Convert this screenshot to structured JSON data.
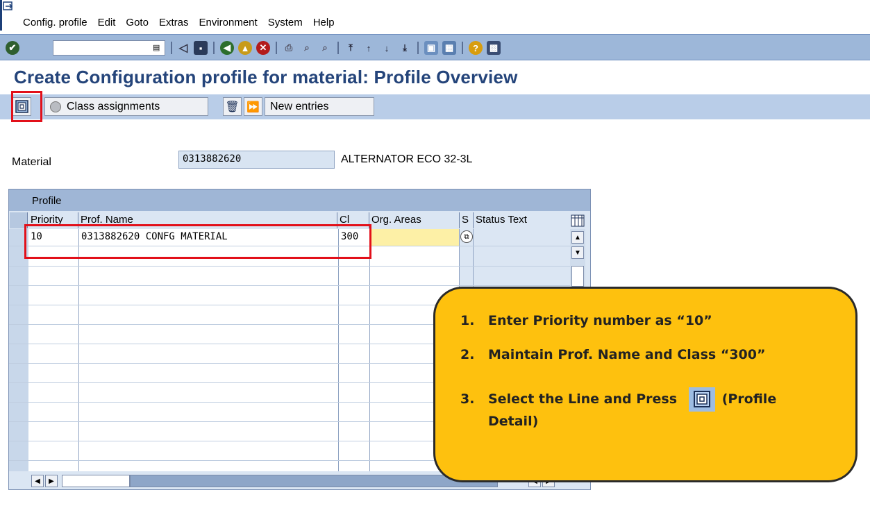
{
  "menu": {
    "items": [
      "Config. profile",
      "Edit",
      "Goto",
      "Extras",
      "Environment",
      "System",
      "Help"
    ]
  },
  "toolbar": {
    "command_field_value": "",
    "icons": [
      "enter-icon",
      "save-icon",
      "back-icon",
      "exit-icon",
      "cancel-icon",
      "print-icon",
      "find-icon",
      "find-next-icon",
      "first-page-icon",
      "prev-page-icon",
      "next-page-icon",
      "last-page-icon",
      "new-session-icon",
      "shortcut-icon",
      "help-icon",
      "layout-icon"
    ]
  },
  "page": {
    "title": "Create Configuration profile for material: Profile Overview"
  },
  "app_toolbar": {
    "class_assignments": "Class assignments",
    "new_entries": "New entries"
  },
  "material": {
    "label": "Material",
    "value": "0313882620",
    "description": "ALTERNATOR ECO 32-3L"
  },
  "table": {
    "caption": "Profile",
    "headers": {
      "priority": "Priority",
      "prof_name": "Prof. Name",
      "cl": "Cl",
      "org_areas": "Org. Areas",
      "s": "S",
      "status_text": "Status Text"
    },
    "rows": [
      {
        "priority": "10",
        "prof_name": "0313882620 CONFG MATERIAL",
        "cl": "300",
        "org_areas": "",
        "s": "",
        "status_text": ""
      }
    ]
  },
  "callout": {
    "step1_num": "1.",
    "step1": "Enter Priority number as “10”",
    "step2_num": "2.",
    "step2": "Maintain Prof. Name and Class “300”",
    "step3_num": "3.",
    "step3_a": "Select the Line and Press",
    "step3_b": "(Profile",
    "step3_c": "Detail)"
  },
  "colors": {
    "title": "#24447a",
    "toolbar": "#9db7d9",
    "highlight": "#e2101a",
    "callout": "#fec10e",
    "org_field": "#fdf0a6"
  }
}
